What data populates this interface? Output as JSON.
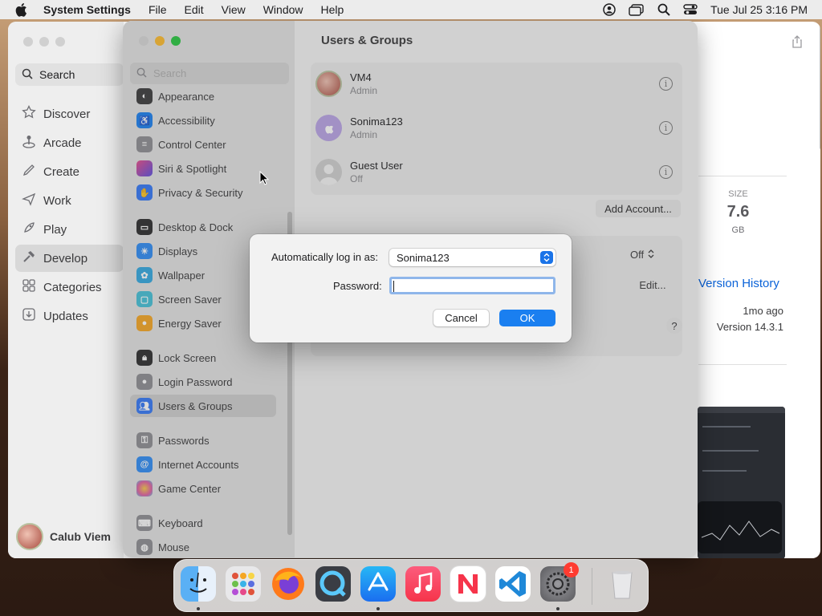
{
  "menubar": {
    "app_name": "System Settings",
    "items": [
      "File",
      "Edit",
      "View",
      "Window",
      "Help"
    ],
    "datetime": "Tue Jul 25  3:16 PM"
  },
  "appstore": {
    "search_label": "Search",
    "sidebar": [
      {
        "label": "Discover",
        "icon": "star-icon"
      },
      {
        "label": "Arcade",
        "icon": "joystick-icon"
      },
      {
        "label": "Create",
        "icon": "brush-icon"
      },
      {
        "label": "Work",
        "icon": "paper-plane-icon"
      },
      {
        "label": "Play",
        "icon": "rocket-icon"
      },
      {
        "label": "Develop",
        "icon": "hammer-icon",
        "selected": true
      },
      {
        "label": "Categories",
        "icon": "grid-icon"
      },
      {
        "label": "Updates",
        "icon": "download-icon"
      }
    ],
    "user_name": "Calub Viem",
    "size_label": "SIZE",
    "size_value": "7.6",
    "size_unit": "GB",
    "version_history": "Version History",
    "updated_ago": "1mo ago",
    "version": "Version 14.3.1"
  },
  "settings": {
    "title": "Users & Groups",
    "search_placeholder": "Search",
    "sidebar": [
      {
        "label": "Appearance",
        "color": "#3a3a3c"
      },
      {
        "label": "Accessibility",
        "color": "#1a7ff0"
      },
      {
        "label": "Control Center",
        "color": "#8e8e93"
      },
      {
        "label": "Siri & Spotlight",
        "color": "#b84fd6"
      },
      {
        "label": "Privacy & Security",
        "color": "#3478f6"
      },
      {
        "label": "Desktop & Dock",
        "color": "#2c2c2e"
      },
      {
        "label": "Displays",
        "color": "#2f8cf5"
      },
      {
        "label": "Wallpaper",
        "color": "#33a8e0"
      },
      {
        "label": "Screen Saver",
        "color": "#45c0d8"
      },
      {
        "label": "Energy Saver",
        "color": "#f5a623"
      },
      {
        "label": "Lock Screen",
        "color": "#2c2c2e"
      },
      {
        "label": "Login Password",
        "color": "#8e8e93"
      },
      {
        "label": "Users & Groups",
        "color": "#3478f6",
        "selected": true
      },
      {
        "label": "Passwords",
        "color": "#8e8e93"
      },
      {
        "label": "Internet Accounts",
        "color": "#2f8cf5"
      },
      {
        "label": "Game Center",
        "color": "#e05fa3"
      },
      {
        "label": "Keyboard",
        "color": "#8e8e93"
      },
      {
        "label": "Mouse",
        "color": "#8e8e93"
      }
    ],
    "users": [
      {
        "name": "VM4",
        "role": "Admin"
      },
      {
        "name": "Sonima123",
        "role": "Admin"
      },
      {
        "name": "Guest User",
        "role": "Off"
      }
    ],
    "add_account": "Add Account...",
    "auto_login_value": "Off",
    "edit_label": "Edit...",
    "help_label": "?"
  },
  "dialog": {
    "auto_login_label": "Automatically log in as:",
    "auto_login_user": "Sonima123",
    "password_label": "Password:",
    "password_value": "",
    "cancel": "Cancel",
    "ok": "OK"
  },
  "dock": {
    "apps": [
      "Finder",
      "Launchpad",
      "Firefox",
      "QuickTime Player",
      "App Store",
      "Music",
      "News",
      "Visual Studio Code",
      "System Settings",
      "Trash"
    ],
    "badge": "1"
  },
  "colors": {
    "accent": "#1a7ff0",
    "menubar": "#ececec"
  }
}
